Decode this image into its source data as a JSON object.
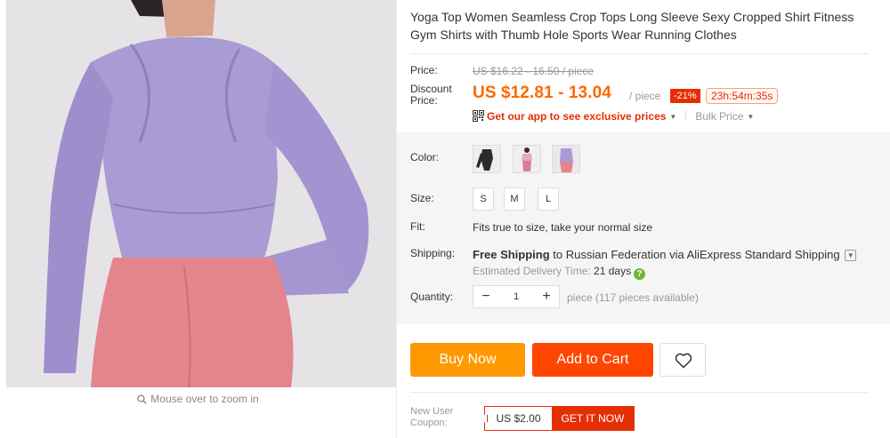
{
  "product": {
    "title": "Yoga Top Women Seamless Crop Tops Long Sleeve Sexy Cropped Shirt Fitness Gym Shirts with Thumb Hole Sports Wear Running Clothes",
    "zoom_hint": "Mouse over to zoom in"
  },
  "price": {
    "label": "Price:",
    "original": "US $16.22 - 16.50 / piece",
    "discount_label_1": "Discount",
    "discount_label_2": "Price:",
    "discount": "US $12.81 - 13.04",
    "unit": "/ piece",
    "discount_badge": "-21%",
    "countdown": "23h:54m:35s",
    "app_link": "Get our app to see exclusive prices",
    "bulk": "Bulk Price"
  },
  "options": {
    "color_label": "Color:",
    "colors": [
      {
        "name": "black",
        "swatch": "#2b2b2b"
      },
      {
        "name": "pink",
        "swatch": "#e5a9bf"
      },
      {
        "name": "purple",
        "swatch": "#a99ad6"
      }
    ],
    "size_label": "Size:",
    "sizes": [
      "S",
      "M",
      "L"
    ],
    "fit_label": "Fit:",
    "fit_text": "Fits true to size, take your normal size"
  },
  "shipping": {
    "label": "Shipping:",
    "bold": "Free Shipping",
    "rest": " to Russian Federation via AliExpress Standard Shipping",
    "eta_label": "Estimated Delivery Time: ",
    "eta_value": "21 days"
  },
  "quantity": {
    "label": "Quantity:",
    "value": "1",
    "minus": "−",
    "plus": "+",
    "stock": "piece (117 pieces available)"
  },
  "actions": {
    "buy_now": "Buy Now",
    "add_to_cart": "Add to Cart"
  },
  "coupon": {
    "label_1": "New User",
    "label_2": "Coupon:",
    "amount": "US $2.00",
    "cta": "GET IT NOW"
  },
  "colors": {
    "accent_orange": "#ff6700",
    "buy_now": "#ff9900",
    "add_to_cart": "#ff4500",
    "sale_red": "#e62e04"
  }
}
